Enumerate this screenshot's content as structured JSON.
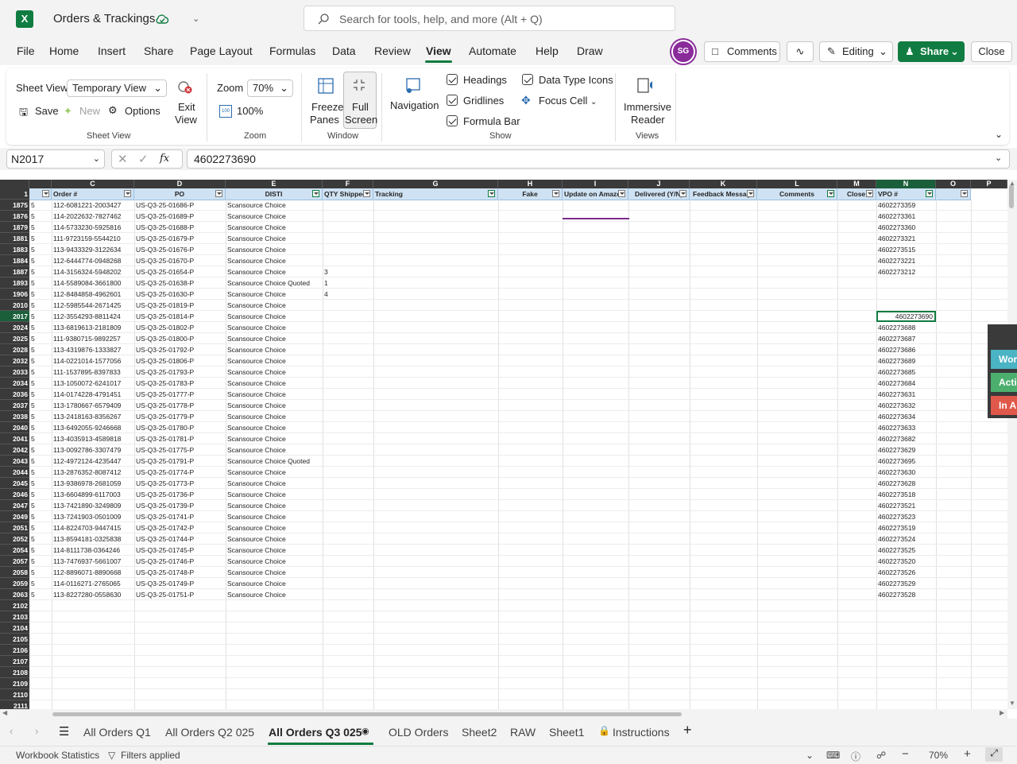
{
  "app": {
    "logo_letter": "X",
    "workbook_title": "Orders & Trackings",
    "search_placeholder": "Search for tools, help, and more (Alt + Q)"
  },
  "menu": {
    "tabs": [
      "File",
      "Home",
      "Insert",
      "Share",
      "Page Layout",
      "Formulas",
      "Data",
      "Review",
      "View",
      "Automate",
      "Help",
      "Draw"
    ],
    "active_tab": "View",
    "avatar_initials": "SG",
    "comments_label": "Comments",
    "editing_label": "Editing",
    "share_label": "Share",
    "close_label": "Close"
  },
  "ribbon": {
    "sheet_view_label": "Sheet View",
    "sheet_view_value": "Temporary View",
    "save_label": "Save",
    "new_label": "New",
    "options_label": "Options",
    "exit_view_label_1": "Exit",
    "exit_view_label_2": "View",
    "group_sheet_view": "Sheet View",
    "zoom_label": "Zoom",
    "zoom_value": "70%",
    "zoom_100_label": "100%",
    "group_zoom": "Zoom",
    "freeze_label_1": "Freeze",
    "freeze_label_2": "Panes",
    "fullscreen_label_1": "Full",
    "fullscreen_label_2": "Screen",
    "group_window": "Window",
    "navigation_label": "Navigation",
    "headings_label": "Headings",
    "gridlines_label": "Gridlines",
    "formula_bar_label": "Formula Bar",
    "data_type_icons_label": "Data Type Icons",
    "focus_cell_label": "Focus Cell",
    "group_show": "Show",
    "immersive_label_1": "Immersive",
    "immersive_label_2": "Reader",
    "group_views": "Views"
  },
  "formula_bar": {
    "name_box": "N2017",
    "formula": "4602273690"
  },
  "grid": {
    "column_letters": [
      "C",
      "D",
      "E",
      "F",
      "G",
      "H",
      "I",
      "J",
      "K",
      "L",
      "M",
      "N",
      "O",
      "P"
    ],
    "corner_row_label": "1",
    "header_labels": {
      "order": "Order #",
      "po": "PO",
      "disti": "DISTI",
      "qty": "QTY Shipped",
      "tracking": "Tracking",
      "fake": "Fake",
      "update": "Update on Amazon",
      "delivered": "Delivered (Y/N)",
      "feedback": "Feedback Message",
      "comments": "Comments",
      "close": "Close",
      "vpo": "VPO #"
    },
    "rows": [
      {
        "row": "1875",
        "b": "5",
        "order": "112-6081221-2003427",
        "po": "US-Q3-25-01686-P",
        "disti": "Scansource Choice",
        "qty": "",
        "vpo": "4602273359"
      },
      {
        "row": "1876",
        "b": "5",
        "order": "114-2022632-7827462",
        "po": "US-Q3-25-01689-P",
        "disti": "Scansource Choice",
        "qty": "",
        "vpo": "4602273361"
      },
      {
        "row": "1879",
        "b": "5",
        "order": "114-5733230-5925816",
        "po": "US-Q3-25-01688-P",
        "disti": "Scansource Choice",
        "qty": "",
        "vpo": "4602273360"
      },
      {
        "row": "1881",
        "b": "5",
        "order": "111-9723159-5544210",
        "po": "US-Q3-25-01679-P",
        "disti": "Scansource Choice",
        "qty": "",
        "vpo": "4602273321"
      },
      {
        "row": "1883",
        "b": "5",
        "order": "113-9433329-3122634",
        "po": "US-Q3-25-01676-P",
        "disti": "Scansource Choice",
        "qty": "",
        "vpo": "4602273515"
      },
      {
        "row": "1884",
        "b": "5",
        "order": "112-6444774-0948268",
        "po": "US-Q3-25-01670-P",
        "disti": "Scansource Choice",
        "qty": "",
        "vpo": "4602273221"
      },
      {
        "row": "1887",
        "b": "5",
        "order": "114-3156324-5948202",
        "po": "US-Q3-25-01654-P",
        "disti": "Scansource Choice",
        "qty": "3",
        "vpo": "4602273212"
      },
      {
        "row": "1893",
        "b": "5",
        "order": "114-5589084-3661800",
        "po": "US-Q3-25-01638-P",
        "disti": "Scansource Choice Quoted",
        "qty": "1",
        "vpo": ""
      },
      {
        "row": "1906",
        "b": "5",
        "order": "112-8484858-4962601",
        "po": "US-Q3-25-01630-P",
        "disti": "Scansource Choice",
        "qty": "4",
        "vpo": ""
      },
      {
        "row": "2010",
        "b": "5",
        "order": "112-5985544-2671425",
        "po": "US-Q3-25-01819-P",
        "disti": "Scansource Choice",
        "qty": "",
        "vpo": ""
      },
      {
        "row": "2017",
        "b": "5",
        "order": "112-3554293-8811424",
        "po": "US-Q3-25-01814-P",
        "disti": "Scansource Choice",
        "qty": "",
        "vpo": "4602273690"
      },
      {
        "row": "2024",
        "b": "5",
        "order": "113-6819613-2181809",
        "po": "US-Q3-25-01802-P",
        "disti": "Scansource Choice",
        "qty": "",
        "vpo": "4602273688"
      },
      {
        "row": "2025",
        "b": "5",
        "order": "111-9380715-9892257",
        "po": "US-Q3-25-01800-P",
        "disti": "Scansource Choice",
        "qty": "",
        "vpo": "4602273687"
      },
      {
        "row": "2028",
        "b": "5",
        "order": "113-4319876-1333827",
        "po": "US-Q3-25-01792-P",
        "disti": "Scansource Choice",
        "qty": "",
        "vpo": "4602273686"
      },
      {
        "row": "2032",
        "b": "5",
        "order": "114-0221014-1577056",
        "po": "US-Q3-25-01806-P",
        "disti": "Scansource Choice",
        "qty": "",
        "vpo": "4602273689"
      },
      {
        "row": "2033",
        "b": "5",
        "order": "111-1537895-8397833",
        "po": "US-Q3-25-01793-P",
        "disti": "Scansource Choice",
        "qty": "",
        "vpo": "4602273685"
      },
      {
        "row": "2034",
        "b": "5",
        "order": "113-1050072-6241017",
        "po": "US-Q3-25-01783-P",
        "disti": "Scansource Choice",
        "qty": "",
        "vpo": "4602273684"
      },
      {
        "row": "2036",
        "b": "5",
        "order": "114-0174228-4791451",
        "po": "US-Q3-25-01777-P",
        "disti": "Scansource Choice",
        "qty": "",
        "vpo": "4602273631"
      },
      {
        "row": "2037",
        "b": "5",
        "order": "113-1780667-6579409",
        "po": "US-Q3-25-01778-P",
        "disti": "Scansource Choice",
        "qty": "",
        "vpo": "4602273632"
      },
      {
        "row": "2038",
        "b": "5",
        "order": "113-2418163-8356267",
        "po": "US-Q3-25-01779-P",
        "disti": "Scansource Choice",
        "qty": "",
        "vpo": "4602273634"
      },
      {
        "row": "2040",
        "b": "5",
        "order": "113-6492055-9246668",
        "po": "US-Q3-25-01780-P",
        "disti": "Scansource Choice",
        "qty": "",
        "vpo": "4602273633"
      },
      {
        "row": "2041",
        "b": "5",
        "order": "113-4035913-4589818",
        "po": "US-Q3-25-01781-P",
        "disti": "Scansource Choice",
        "qty": "",
        "vpo": "4602273682"
      },
      {
        "row": "2042",
        "b": "5",
        "order": "113-0092786-3307479",
        "po": "US-Q3-25-01775-P",
        "disti": "Scansource Choice",
        "qty": "",
        "vpo": "4602273629"
      },
      {
        "row": "2043",
        "b": "5",
        "order": "112-4972124-4235447",
        "po": "US-Q3-25-01791-P",
        "disti": "Scansource Choice Quoted",
        "qty": "",
        "vpo": "4602273695"
      },
      {
        "row": "2044",
        "b": "5",
        "order": "113-2876352-8087412",
        "po": "US-Q3-25-01774-P",
        "disti": "Scansource Choice",
        "qty": "",
        "vpo": "4602273630"
      },
      {
        "row": "2045",
        "b": "5",
        "order": "113-9386978-2681059",
        "po": "US-Q3-25-01773-P",
        "disti": "Scansource Choice",
        "qty": "",
        "vpo": "4602273628"
      },
      {
        "row": "2046",
        "b": "5",
        "order": "113-6604899-6117003",
        "po": "US-Q3-25-01736-P",
        "disti": "Scansource Choice",
        "qty": "",
        "vpo": "4602273518"
      },
      {
        "row": "2047",
        "b": "5",
        "order": "113-7421890-3249809",
        "po": "US-Q3-25-01739-P",
        "disti": "Scansource Choice",
        "qty": "",
        "vpo": "4602273521"
      },
      {
        "row": "2049",
        "b": "5",
        "order": "113-7241903-0501009",
        "po": "US-Q3-25-01741-P",
        "disti": "Scansource Choice",
        "qty": "",
        "vpo": "4602273523"
      },
      {
        "row": "2051",
        "b": "5",
        "order": "114-8224703-9447415",
        "po": "US-Q3-25-01742-P",
        "disti": "Scansource Choice",
        "qty": "",
        "vpo": "4602273519"
      },
      {
        "row": "2052",
        "b": "5",
        "order": "113-8594181-0325838",
        "po": "US-Q3-25-01744-P",
        "disti": "Scansource Choice",
        "qty": "",
        "vpo": "4602273524"
      },
      {
        "row": "2054",
        "b": "5",
        "order": "114-8111738-0364246",
        "po": "US-Q3-25-01745-P",
        "disti": "Scansource Choice",
        "qty": "",
        "vpo": "4602273525"
      },
      {
        "row": "2057",
        "b": "5",
        "order": "113-7476937-5661007",
        "po": "US-Q3-25-01746-P",
        "disti": "Scansource Choice",
        "qty": "",
        "vpo": "4602273520"
      },
      {
        "row": "2058",
        "b": "5",
        "order": "112-8896071-8890668",
        "po": "US-Q3-25-01748-P",
        "disti": "Scansource Choice",
        "qty": "",
        "vpo": "4602273526"
      },
      {
        "row": "2059",
        "b": "5",
        "order": "114-0116271-2765065",
        "po": "US-Q3-25-01749-P",
        "disti": "Scansource Choice",
        "qty": "",
        "vpo": "4602273529"
      },
      {
        "row": "2063",
        "b": "5",
        "order": "113-8227280-0558630",
        "po": "US-Q3-25-01751-P",
        "disti": "Scansource Choice",
        "qty": "",
        "vpo": "4602273528"
      },
      {
        "row": "2102",
        "b": "",
        "order": "",
        "po": "",
        "disti": "",
        "qty": "",
        "vpo": ""
      },
      {
        "row": "2103",
        "b": "",
        "order": "",
        "po": "",
        "disti": "",
        "qty": "",
        "vpo": ""
      },
      {
        "row": "2104",
        "b": "",
        "order": "",
        "po": "",
        "disti": "",
        "qty": "",
        "vpo": ""
      },
      {
        "row": "2105",
        "b": "",
        "order": "",
        "po": "",
        "disti": "",
        "qty": "",
        "vpo": ""
      },
      {
        "row": "2106",
        "b": "",
        "order": "",
        "po": "",
        "disti": "",
        "qty": "",
        "vpo": ""
      },
      {
        "row": "2107",
        "b": "",
        "order": "",
        "po": "",
        "disti": "",
        "qty": "",
        "vpo": ""
      },
      {
        "row": "2108",
        "b": "",
        "order": "",
        "po": "",
        "disti": "",
        "qty": "",
        "vpo": ""
      },
      {
        "row": "2109",
        "b": "",
        "order": "",
        "po": "",
        "disti": "",
        "qty": "",
        "vpo": ""
      },
      {
        "row": "2110",
        "b": "",
        "order": "",
        "po": "",
        "disti": "",
        "qty": "",
        "vpo": ""
      },
      {
        "row": "2111",
        "b": "",
        "order": "",
        "po": "",
        "disti": "",
        "qty": "",
        "vpo": ""
      }
    ],
    "selected_row": "2017",
    "selected_column": "N"
  },
  "side_pane": {
    "items": [
      {
        "label": "Wor",
        "color": "#4ab3c4"
      },
      {
        "label": "Acti",
        "color": "#4caf6e"
      },
      {
        "label": "In A",
        "color": "#e0584a"
      }
    ]
  },
  "sheet_tabs": {
    "tabs": [
      "All Orders Q1",
      "All Orders Q2 025",
      "All Orders Q3 025",
      "OLD Orders",
      "Sheet2",
      "RAW",
      "Sheet1",
      "Instructions"
    ],
    "active": "All Orders Q3 025"
  },
  "status": {
    "workbook_statistics": "Workbook Statistics",
    "filters_applied": "Filters applied",
    "zoom": "70%"
  },
  "colors": {
    "brand_green": "#107c41",
    "header_fill": "#cfe2f3",
    "avatar_purple": "#8a2b9a"
  }
}
